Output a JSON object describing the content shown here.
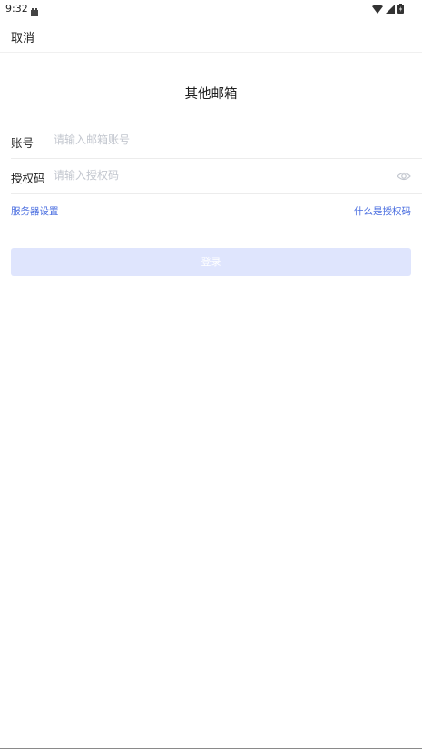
{
  "status_bar": {
    "time": "9:32",
    "icons": [
      "app-notification-icon",
      "wifi-icon",
      "cellular-signal-icon",
      "battery-icon"
    ]
  },
  "nav": {
    "cancel_label": "取消"
  },
  "page": {
    "title": "其他邮箱"
  },
  "form": {
    "account_label": "账号",
    "account_placeholder": "请输入邮箱账号",
    "account_value": "",
    "auth_label": "授权码",
    "auth_placeholder": "请输入授权码",
    "auth_value": "",
    "auth_toggle_icon": "eye-icon"
  },
  "links": {
    "server_settings": "服务器设置",
    "what_is_auth_code": "什么是授权码"
  },
  "login_button_label": "登录",
  "colors": {
    "accent": "#4a6ee0",
    "button_disabled_bg": "#dfe5fd",
    "placeholder": "#c3c7cf"
  }
}
